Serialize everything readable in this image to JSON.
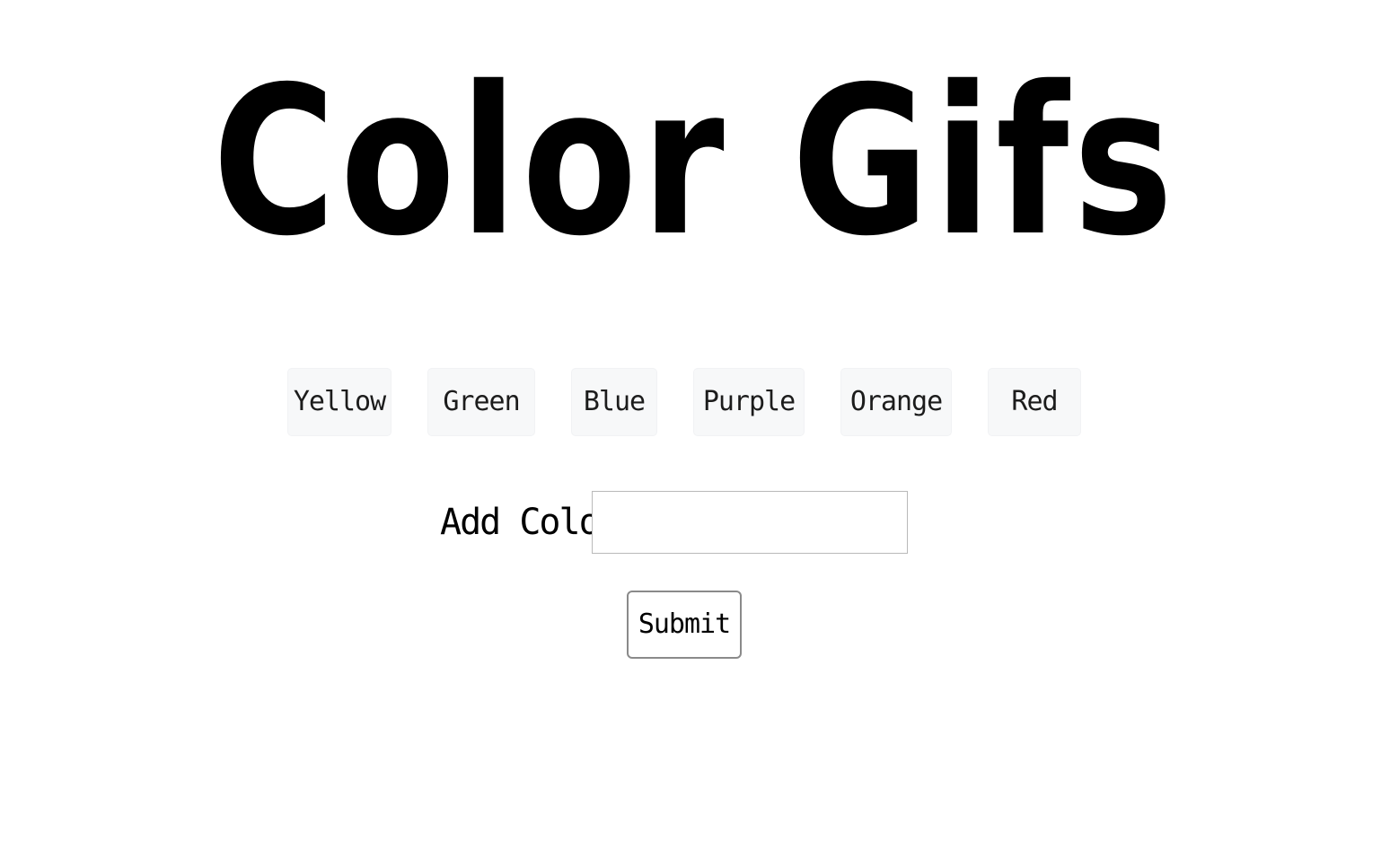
{
  "header": {
    "title": "Color Gifs"
  },
  "colors": {
    "buttons": [
      {
        "label": "Yellow"
      },
      {
        "label": "Green"
      },
      {
        "label": "Blue"
      },
      {
        "label": "Purple"
      },
      {
        "label": "Orange"
      },
      {
        "label": "Red"
      }
    ]
  },
  "form": {
    "label": "Add Color",
    "input_value": "",
    "input_placeholder": "",
    "submit_label": "Submit"
  },
  "theme": {
    "background": "#ffffff",
    "text": "#000000",
    "button_background": "#f7f8f9"
  }
}
